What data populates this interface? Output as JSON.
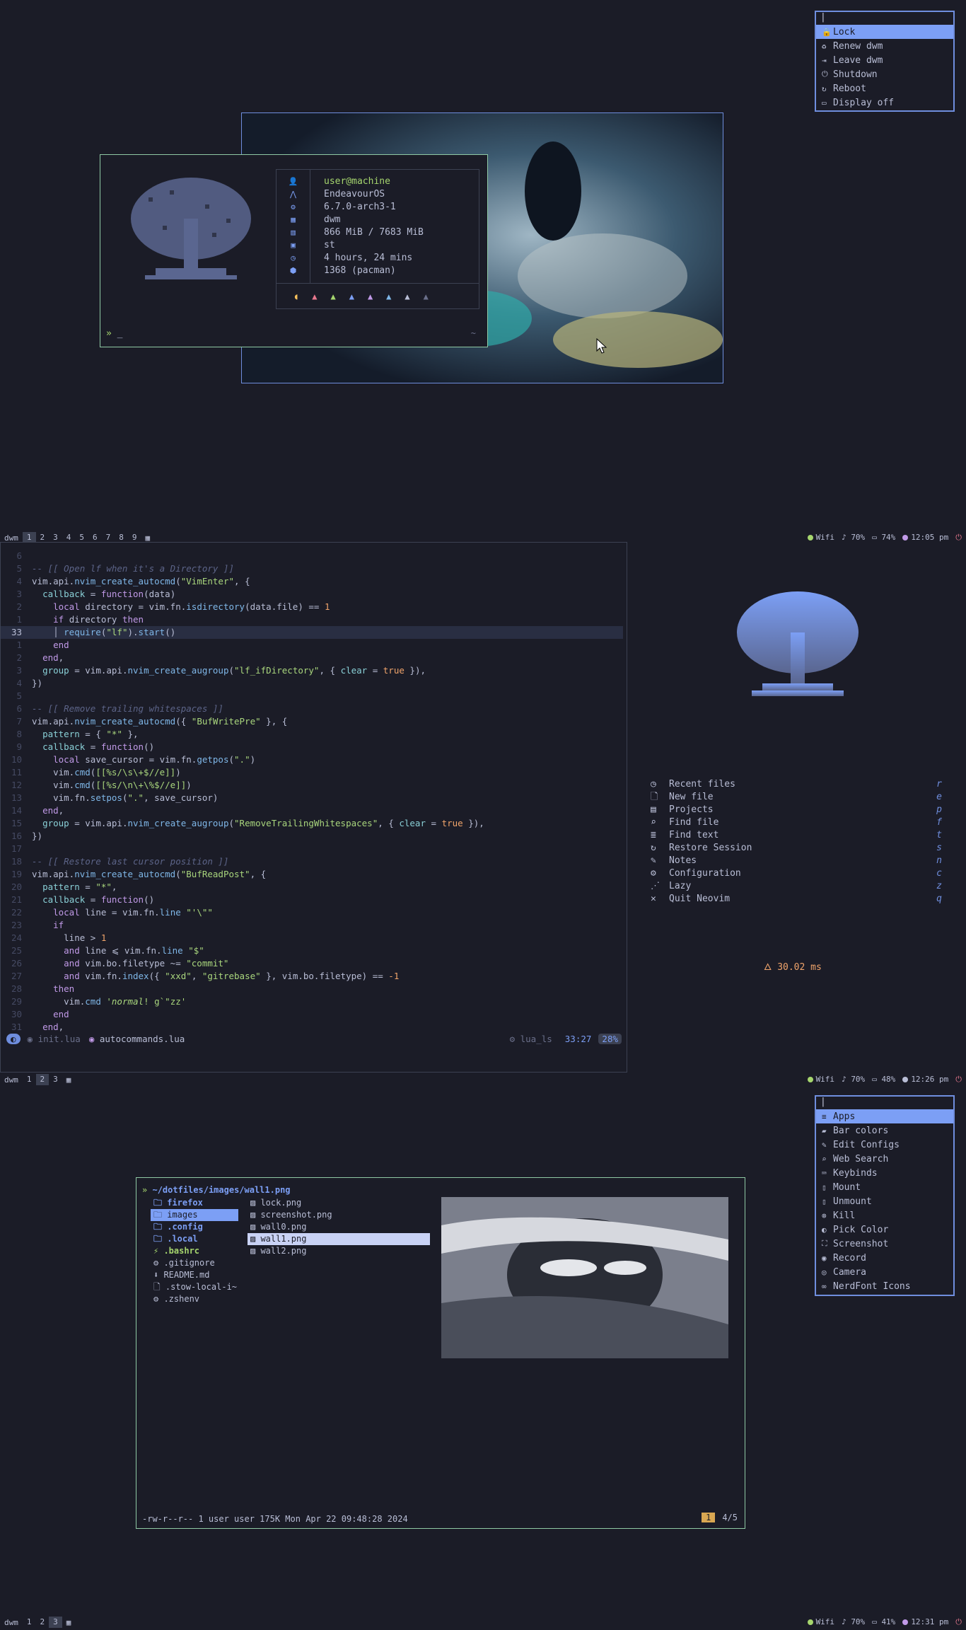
{
  "power_menu": {
    "items": [
      {
        "icon": "lock-icon",
        "label": "Lock",
        "selected": true
      },
      {
        "icon": "renew-icon",
        "label": "Renew dwm"
      },
      {
        "icon": "leave-icon",
        "label": "Leave dwm"
      },
      {
        "icon": "power-icon",
        "label": "Shutdown"
      },
      {
        "icon": "reboot-icon",
        "label": "Reboot"
      },
      {
        "icon": "display-off-icon",
        "label": "Display off"
      }
    ]
  },
  "fetch": {
    "prompt_symbol": "»",
    "prompt_cursor": "_",
    "prompt_dir": "~",
    "lines": [
      {
        "icon": "user-icon",
        "value": "user@machine"
      },
      {
        "icon": "distro-icon",
        "value": "EndeavourOS"
      },
      {
        "icon": "gear-icon",
        "value": "6.7.0-arch3-1"
      },
      {
        "icon": "wm-icon",
        "value": "dwm"
      },
      {
        "icon": "memory-icon",
        "value": "866 MiB / 7683 MiB"
      },
      {
        "icon": "terminal-icon",
        "value": "st"
      },
      {
        "icon": "uptime-icon",
        "value": "4 hours, 24 mins"
      },
      {
        "icon": "package-icon",
        "value": "1368 (pacman)"
      }
    ],
    "colors": [
      "#f6c05b",
      "#e8788e",
      "#a6d66e",
      "#7c9ff5",
      "#c19ae8",
      "#7fb7e8",
      "#b9bed6",
      "#6a6f8a"
    ]
  },
  "bar1": {
    "wm": "dwm",
    "tags": [
      "1",
      "2",
      "3",
      "4",
      "5",
      "6",
      "7",
      "8",
      "9"
    ],
    "active": "1",
    "wifi": "Wifi",
    "volume": "70%",
    "battery": "74%",
    "time": "12:05 pm"
  },
  "bar2": {
    "wm": "dwm",
    "tags": [
      "1",
      "2",
      "3"
    ],
    "active": "2",
    "wifi": "Wifi",
    "volume": "70%",
    "battery": "48%",
    "time": "12:26 pm"
  },
  "bar3": {
    "wm": "dwm",
    "tags": [
      "1",
      "2",
      "3"
    ],
    "active": "3",
    "wifi": "Wifi",
    "volume": "70%",
    "battery": "41%",
    "time": "12:31 pm"
  },
  "editor": {
    "statusline": {
      "file1": "init.lua",
      "file2": "autocommands.lua",
      "lsp": "lua_ls",
      "pos": "33:27",
      "pct": "28%"
    }
  },
  "dashboard": {
    "items": [
      {
        "icon": "clock-icon",
        "label": "Recent files",
        "key": "r"
      },
      {
        "icon": "file-plus-icon",
        "label": "New file",
        "key": "e"
      },
      {
        "icon": "projects-icon",
        "label": "Projects",
        "key": "p"
      },
      {
        "icon": "search-icon",
        "label": "Find file",
        "key": "f"
      },
      {
        "icon": "text-search-icon",
        "label": "Find text",
        "key": "t"
      },
      {
        "icon": "restore-icon",
        "label": "Restore Session",
        "key": "s"
      },
      {
        "icon": "notes-icon",
        "label": "Notes",
        "key": "n"
      },
      {
        "icon": "gear-icon",
        "label": "Configuration",
        "key": "c"
      },
      {
        "icon": "lazy-icon",
        "label": "Lazy",
        "key": "z"
      },
      {
        "icon": "close-icon",
        "label": "Quit Neovim",
        "key": "q"
      }
    ],
    "startup": "30.02 ms"
  },
  "apps_menu": {
    "items": [
      {
        "icon": "apps-icon",
        "label": "Apps",
        "selected": true
      },
      {
        "icon": "paint-icon",
        "label": "Bar colors"
      },
      {
        "icon": "edit-icon",
        "label": "Edit Configs"
      },
      {
        "icon": "search-icon",
        "label": "Web Search"
      },
      {
        "icon": "keyboard-icon",
        "label": "Keybinds"
      },
      {
        "icon": "mount-icon",
        "label": "Mount"
      },
      {
        "icon": "unmount-icon",
        "label": "Unmount"
      },
      {
        "icon": "kill-icon",
        "label": "Kill"
      },
      {
        "icon": "color-picker-icon",
        "label": "Pick Color"
      },
      {
        "icon": "screenshot-icon",
        "label": "Screenshot"
      },
      {
        "icon": "record-icon",
        "label": "Record"
      },
      {
        "icon": "camera-icon",
        "label": "Camera"
      },
      {
        "icon": "nerdfont-icon",
        "label": "NerdFont Icons"
      }
    ]
  },
  "lf": {
    "path": "~/dotfiles/images/wall1.png",
    "left": [
      {
        "icon": "folder-icon",
        "label": "firefox",
        "type": "dir"
      },
      {
        "icon": "folder-icon",
        "label": "images",
        "type": "dir",
        "selected": true
      },
      {
        "icon": "folder-icon",
        "label": ".config",
        "type": "dir"
      },
      {
        "icon": "folder-icon",
        "label": ".local",
        "type": "dir"
      },
      {
        "icon": "shell-icon",
        "label": ".bashrc",
        "type": "exec"
      },
      {
        "icon": "gear-icon",
        "label": ".gitignore",
        "type": "file"
      },
      {
        "icon": "readme-icon",
        "label": "README.md",
        "type": "file"
      },
      {
        "icon": "file-icon",
        "label": ".stow-local-i~",
        "type": "file"
      },
      {
        "icon": "gear-icon",
        "label": ".zshenv",
        "type": "file"
      }
    ],
    "middle": [
      {
        "label": "lock.png"
      },
      {
        "label": "screenshot.png"
      },
      {
        "label": "wall0.png"
      },
      {
        "label": "wall1.png",
        "selected": true
      },
      {
        "label": "wall2.png"
      }
    ],
    "status": "-rw-r--r-- 1 user user 175K Mon Apr 22 09:48:28 2024",
    "badge": "1",
    "count": "4/5"
  }
}
